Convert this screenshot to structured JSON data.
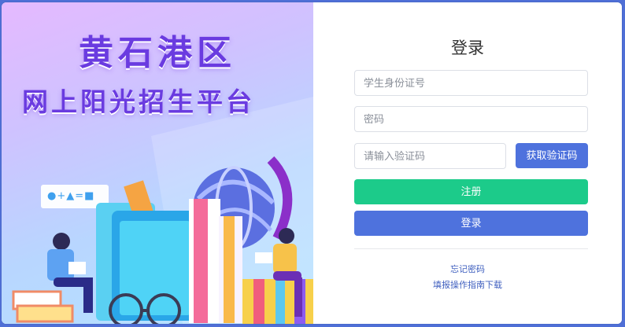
{
  "colors": {
    "page_background": "#4f6fd6",
    "title_purple": "#6a3be0",
    "register_green": "#1ccb8a",
    "primary_blue": "#4e72dd",
    "link_blue": "#3f5fbf"
  },
  "banner": {
    "title_line1": "黄石港区",
    "title_line2": "网上阳光招生平台",
    "formula_text": "●+▲=■"
  },
  "login": {
    "title": "登录",
    "id_placeholder": "学生身份证号",
    "password_placeholder": "密码",
    "captcha_placeholder": "请输入验证码",
    "get_code_label": "获取验证码",
    "register_label": "注册",
    "login_label": "登录",
    "forgot_password": "忘记密码",
    "guide_download": "填报操作指南下载"
  }
}
